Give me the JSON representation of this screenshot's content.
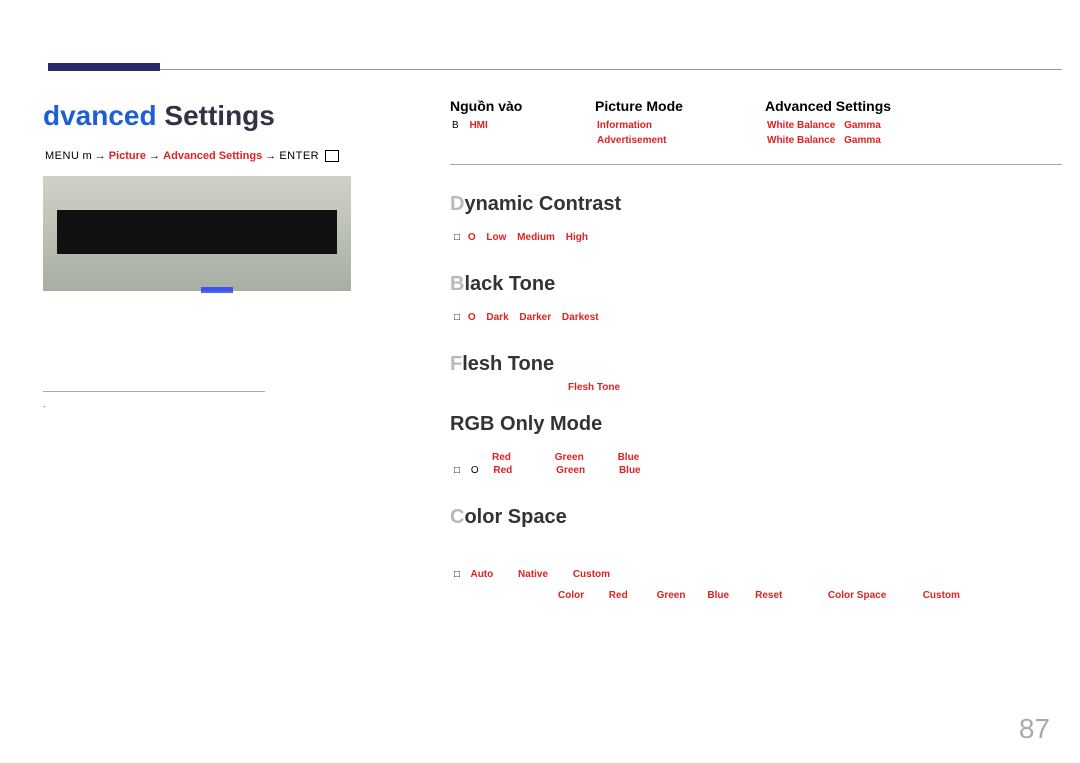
{
  "page_number": "87",
  "left": {
    "title_blue": "dvanced ",
    "title_dark": "Settings",
    "menu_prefix": "MENU",
    "menu_m": "m",
    "menu_arrow": " → ",
    "bc_picture": "Picture",
    "bc_adv": "Advanced Settings",
    "bc_enter": "ENTER"
  },
  "table": {
    "h1": "Nguồn vào",
    "h2": "Picture Mode",
    "h3": "Advanced Settings",
    "r1c1_b": "B",
    "r1c1_hmi": "HMI",
    "r1c2": "Information",
    "r1c3a": "White Balance",
    "r1c3b": "Gamma",
    "r2c2": "Advertisement",
    "r2c3a": "White Balance",
    "r2c3b": "Gamma"
  },
  "sections": {
    "dyn_lead": "D",
    "dyn_rest": "ynamic Contrast",
    "dyn_opts": [
      "Low",
      "Medium",
      "High"
    ],
    "black_lead": "B",
    "black_rest": "lack Tone",
    "black_opts": [
      "Dark",
      "Darker",
      "Darkest"
    ],
    "flesh_lead": "F",
    "flesh_rest": "lesh Tone",
    "flesh_center": "Flesh Tone",
    "rgb_lead": "RGB O",
    "rgb_rest": "nly Mode",
    "rgb_l1": [
      "Red",
      "Green",
      "Blue"
    ],
    "rgb_l2": [
      "Red",
      "Green",
      "Blue"
    ],
    "cs_lead": "C",
    "cs_rest": "olor Space",
    "cs_l1": [
      "Auto",
      "Native",
      "Custom"
    ],
    "cs_l2": [
      "Color",
      "Red",
      "Green",
      "Blue",
      "Reset",
      "Color Space",
      "Custom"
    ]
  },
  "misc": {
    "off_square": "□",
    "off_o": "O"
  }
}
